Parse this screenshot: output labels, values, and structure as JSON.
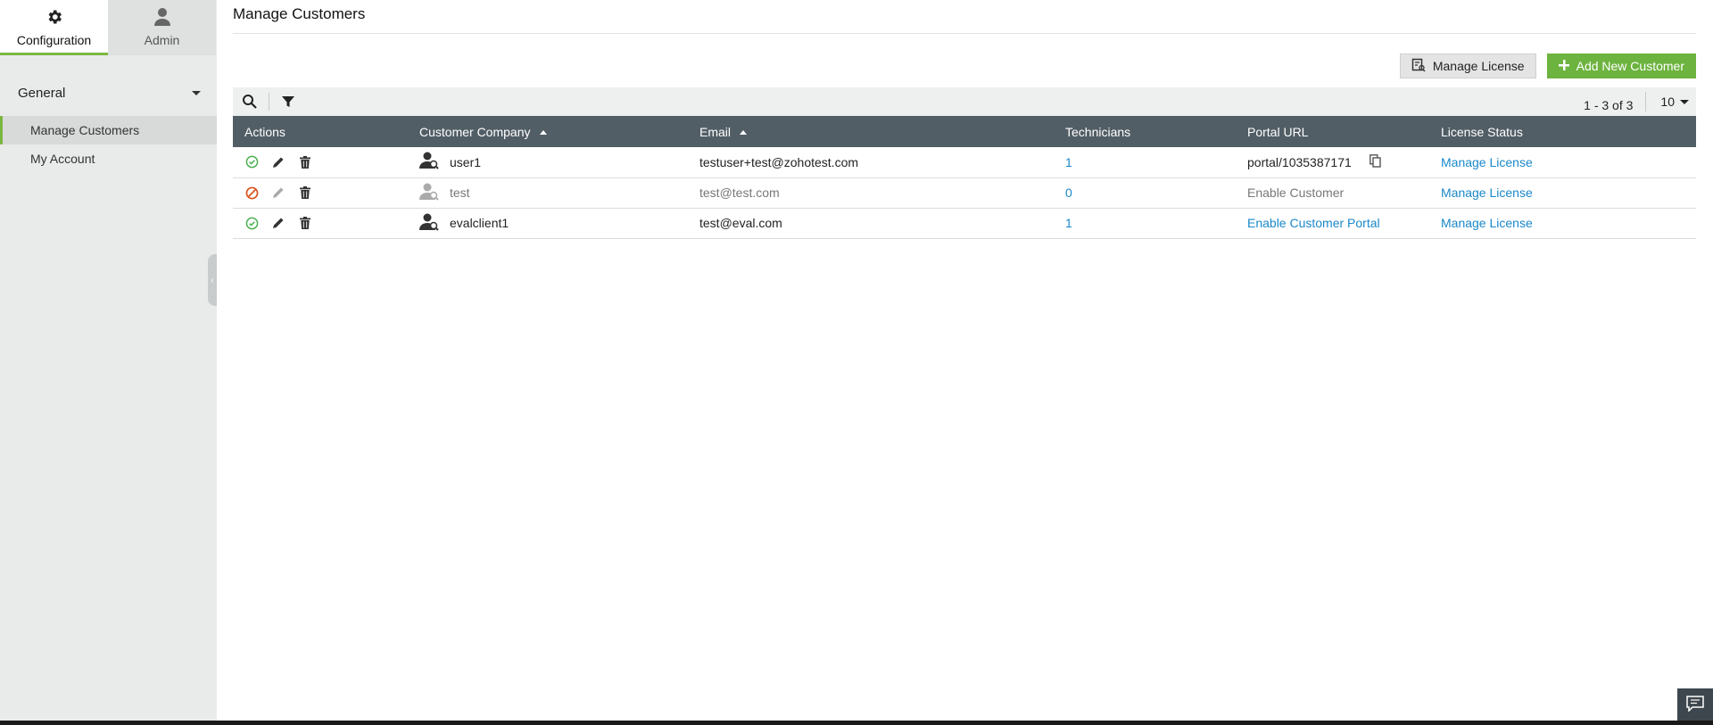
{
  "sidebar": {
    "tabs": [
      {
        "label": "Configuration",
        "icon": "gear-icon"
      },
      {
        "label": "Admin",
        "icon": "user-icon"
      }
    ],
    "section_title": "General",
    "items": [
      {
        "label": "Manage Customers"
      },
      {
        "label": "My Account"
      }
    ]
  },
  "main": {
    "title": "Manage Customers",
    "buttons": {
      "manage_license": "Manage License",
      "add_customer": "Add New Customer"
    },
    "toolbar": {
      "pager": "1 - 3 of 3",
      "page_size": "10"
    },
    "table": {
      "columns": [
        "Actions",
        "Customer Company",
        "Email",
        "Technicians",
        "Portal URL",
        "License Status"
      ],
      "rows": [
        {
          "status": "enabled",
          "company": "user1",
          "email": "testuser+test@zohotest.com",
          "technicians": "1",
          "portal": "portal/1035387171",
          "license": "Manage License"
        },
        {
          "status": "disabled",
          "company": "test",
          "email": "test@test.com",
          "technicians": "0",
          "portal": "Enable Customer",
          "license": "Manage License"
        },
        {
          "status": "enabled",
          "company": "evalclient1",
          "email": "test@eval.com",
          "technicians": "1",
          "portal": "Enable Customer Portal",
          "license": "Manage License"
        }
      ]
    }
  },
  "colors": {
    "accent_green": "#6db33f",
    "header_bg": "#525e66",
    "link_blue": "#1a88c9",
    "disabled_orange": "#d9531e"
  }
}
